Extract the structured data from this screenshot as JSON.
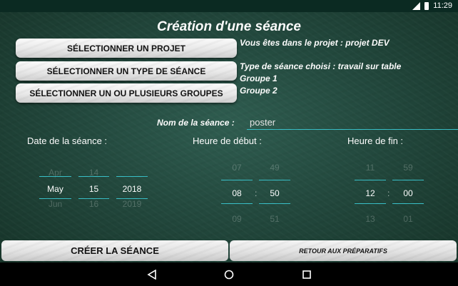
{
  "status_bar": {
    "time": "11:29"
  },
  "title": "Création d'une séance",
  "buttons": {
    "select_project": "SÉLECTIONNER UN PROJET",
    "select_type": "SÉLECTIONNER UN TYPE DE SÉANCE",
    "select_groups": "SÉLECTIONNER UN OU PLUSIEURS GROUPES",
    "create": "CRÉER LA SÉANCE",
    "back": "RETOUR AUX PRÉPARATIFS"
  },
  "info": {
    "project": "Vous êtes dans le projet : projet DEV",
    "type": "Type de séance choisi : travail sur table",
    "groups": [
      "Groupe 1",
      "Groupe 2"
    ]
  },
  "session_name": {
    "label": "Nom de la séance :",
    "value": "poster"
  },
  "date": {
    "label": "Date de la séance :",
    "month": {
      "prev": "Apr",
      "selected": "May",
      "next": "Jun"
    },
    "day": {
      "prev": "14",
      "selected": "15",
      "next": "16"
    },
    "year": {
      "prev": "2018",
      "selected": "2018",
      "next": "2019"
    }
  },
  "start": {
    "label": "Heure de début :",
    "hour": {
      "prev": "07",
      "selected": "08",
      "next": "09"
    },
    "minute": {
      "prev": "49",
      "selected": "50",
      "next": "51"
    }
  },
  "end": {
    "label": "Heure de fin :",
    "hour": {
      "prev": "11",
      "selected": "12",
      "next": "13"
    },
    "minute": {
      "prev": "59",
      "selected": "00",
      "next": "01"
    }
  }
}
